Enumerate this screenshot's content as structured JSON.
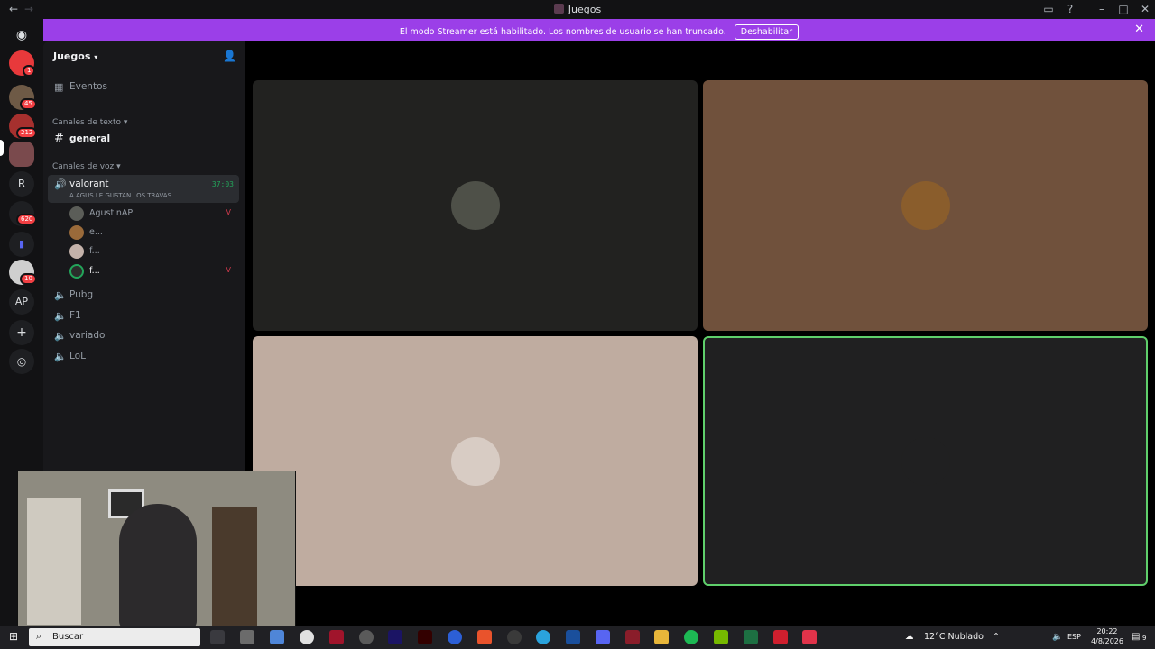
{
  "window": {
    "title": "Juegos"
  },
  "banner": {
    "message": "El modo Streamer está habilitado. Los nombres de usuario se han truncado.",
    "button": "Deshabilitar"
  },
  "rail": {
    "badges": [
      "1",
      "45",
      "212",
      "620",
      "10"
    ],
    "letter_server": "R",
    "initials_server": "AP"
  },
  "sidebar": {
    "server_name": "Juegos",
    "events": "Eventos",
    "text_category": "Canales de texto",
    "text_channels": [
      "general"
    ],
    "voice_category": "Canales de voz",
    "active_voice": {
      "name": "valorant",
      "timer": "37:03",
      "status": "A AGUS LE GUSTAN LOS TRAVAS",
      "members": [
        "AgustinAP",
        "e...",
        "f...",
        "f..."
      ]
    },
    "voice_channels": [
      "Pubg",
      "F1",
      "variado",
      "LoL"
    ]
  },
  "taskbar": {
    "search_placeholder": "Buscar",
    "weather": "12°C  Nublado",
    "lang": "ESP",
    "time": "20:22",
    "date": "4/8/2026",
    "notifications": "9"
  },
  "colors": {
    "banner": "#9b3fe8",
    "tile1": "#222220",
    "tile2": "#70513c",
    "tile3": "#bfaca0",
    "tile4": "#202021",
    "speaking_outline": "#5fcf6b"
  }
}
